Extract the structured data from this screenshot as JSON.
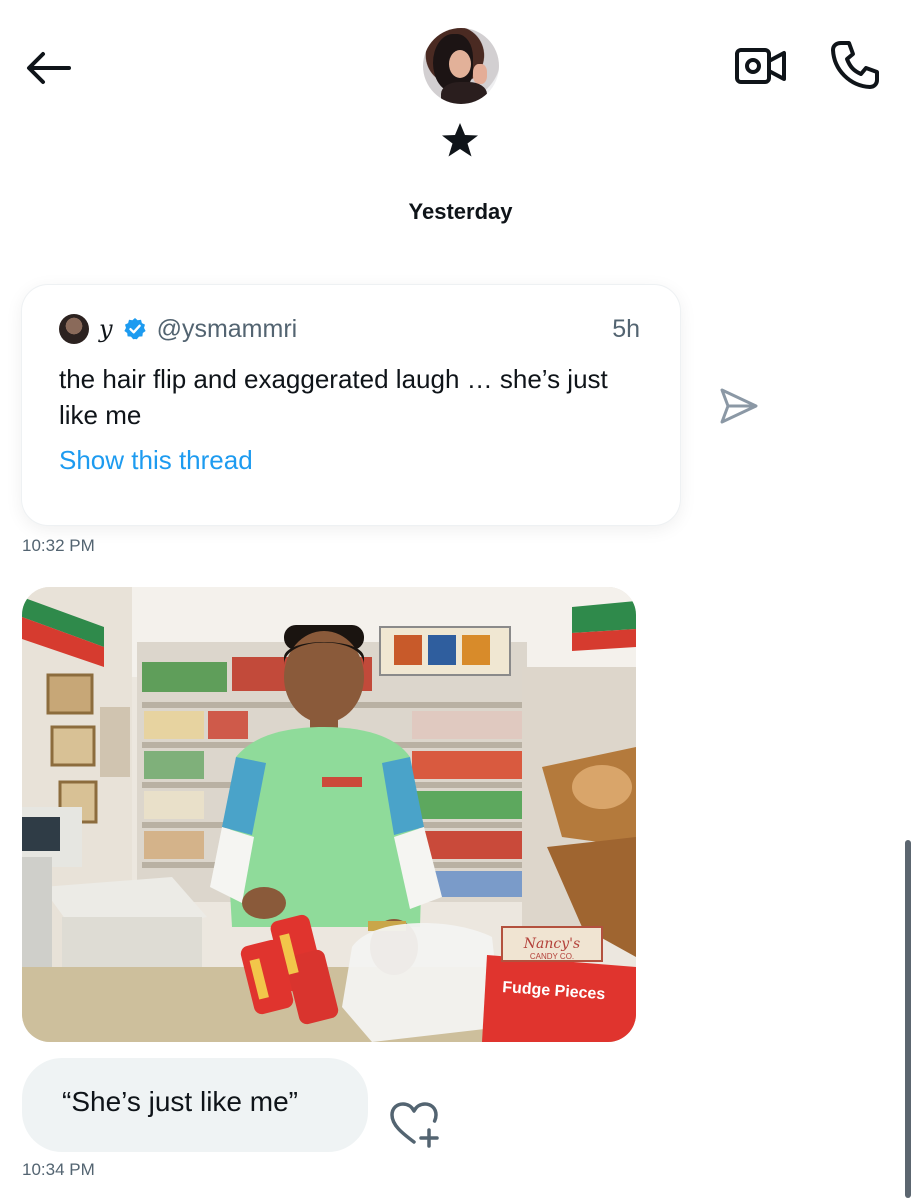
{
  "header": {
    "back_icon": "arrow-left-icon",
    "star_icon": "star-icon",
    "video_icon": "video-camera-icon",
    "call_icon": "phone-icon"
  },
  "date_divider": "Yesterday",
  "messages": [
    {
      "type": "shared_tweet",
      "author_name": "y",
      "verified": true,
      "handle": "@ysmammri",
      "age": "5h",
      "text": "the hair flip and exaggerated laugh … she’s just like me",
      "link_label": "Show this thread",
      "timestamp": "10:32 PM"
    },
    {
      "type": "photo",
      "description_icon": "photo-attachment",
      "visible_signs": {
        "box_label": "Fudge Pieces",
        "brand_label": "Nancy's",
        "brand_sub": "CANDY CO."
      }
    },
    {
      "type": "text",
      "text": "“She’s just like me”",
      "timestamp": "10:34 PM"
    }
  ],
  "colors": {
    "link_blue": "#1d9bf0",
    "verified_blue": "#1d9bf0",
    "secondary_text": "#536471",
    "bubble_bg": "#eff3f4"
  }
}
